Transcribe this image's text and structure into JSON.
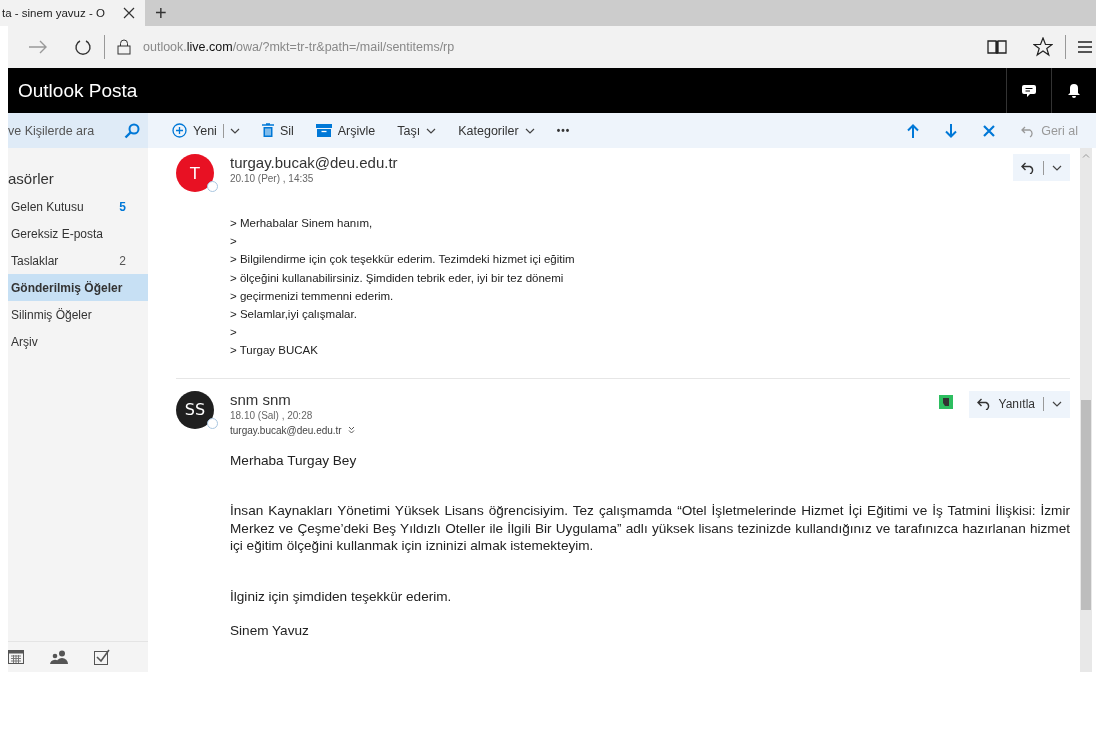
{
  "browser": {
    "tab_title": "ta - sinem yavuz - O",
    "new_tab": "+",
    "url": "outlook.**live.com**/owa/?mkt=tr-tr&path=/mail/sentitems/rp"
  },
  "app": {
    "title": "Outlook Posta"
  },
  "search": {
    "placeholder": "ve Kişilerde ara"
  },
  "toolbar": [
    {
      "kind": "new",
      "label": "Yeni"
    },
    {
      "kind": "delete",
      "label": "Sil"
    },
    {
      "kind": "archive",
      "label": "Arşivle"
    },
    {
      "kind": "menu",
      "label": "Taşı"
    },
    {
      "kind": "menu",
      "label": "Kategoriler"
    },
    {
      "kind": "more",
      "label": "•••"
    }
  ],
  "undo": {
    "label": "Geri al",
    "disabled": true
  },
  "folders": {
    "heading": "asörler",
    "items": [
      {
        "label": "Gelen Kutusu",
        "count": "5",
        "unread": true,
        "selected": false
      },
      {
        "label": "Gereksiz E-posta",
        "selected": false
      },
      {
        "label": "Taslaklar",
        "count": "2",
        "unread": false,
        "selected": false
      },
      {
        "label": "Gönderilmiş Öğeler",
        "selected": true
      },
      {
        "label": "Silinmiş Öğeler",
        "selected": false
      },
      {
        "label": "Arşiv",
        "selected": false
      }
    ]
  },
  "messages": [
    {
      "initials": "T",
      "color": "#e81123",
      "sender": "turgay.bucak@deu.edu.tr",
      "date": "20.10 (Per) , 14:35",
      "quoted": true,
      "body": [
        "> Merhabalar Sinem hanım,",
        ">",
        "> Bilgilendirme için çok teşekkür ederim. Tezimdeki hizmet içi eğitim",
        "> ölçeğini kullanabilirsiniz. Şimdiden tebrik eder, iyi bir tez dönemi",
        "> geçirmenizi temmenni ederim.",
        "> Selamlar,iyi çalışmalar.",
        ">",
        "> Turgay BUCAK"
      ]
    },
    {
      "initials": "SS",
      "color": "#1f1f1f",
      "sender": "snm snm",
      "date": "18.10 (Sal) , 20:28",
      "to": "turgay.bucak@deu.edu.tr",
      "reply_label": "Yanıtla",
      "quoted": false,
      "body": [
        "Merhaba Turgay Bey",
        "İnsan Kaynakları Yönetimi Yüksek Lisans öğrencisiyim. Tez çalışmamda “Otel İşletmelerinde Hizmet İçi Eğitimi ve İş Tatmini İlişkisi: İzmir Merkez ve Çeşme’deki Beş Yıldızlı Oteller ile İlgili Bir Uygulama” adlı yüksek lisans tezinizde kullandığınız ve tarafınızca hazırlanan hizmet içi eğitim ölçeğini kullanmak için izninizi almak istemekteyim.",
        "İlginiz için şimdiden teşekkür ederim.",
        "Sinem Yavuz"
      ]
    }
  ]
}
